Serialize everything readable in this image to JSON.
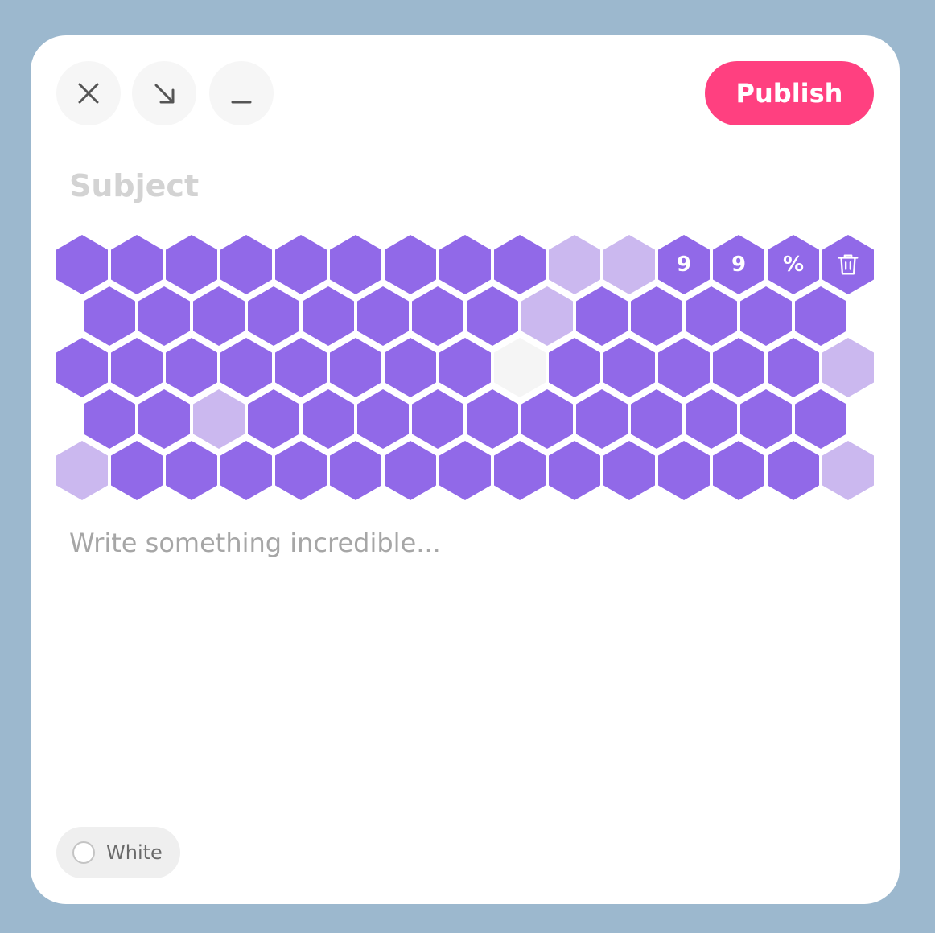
{
  "window_controls": {
    "close_icon": "close-icon",
    "resize_icon": "arrow-down-right-icon",
    "minimize_icon": "minimize-icon"
  },
  "publish_label": "Publish",
  "subject": {
    "value": "",
    "placeholder": "Subject"
  },
  "body": {
    "value": "",
    "placeholder": "Write something incredible..."
  },
  "theme_toggle": {
    "label": "White",
    "selected": false
  },
  "colors": {
    "background": "#9cb8ce",
    "card": "#ffffff",
    "publish": "#ff4080",
    "hex_filled": "#9169e8",
    "hex_light": "#cbb8ef",
    "hex_empty": "#f5f5f5"
  },
  "honeycomb": {
    "legend": "f = filled purple, l = light lavender, e = empty gray",
    "rows": [
      "fffffffffllfffff",
      "fffffffflfffff",
      "ffffffffefffffl",
      "fflfffffffffff",
      "lffffffffffffflf"
    ],
    "overlay": [
      {
        "row": 0,
        "col": 11,
        "text": "9"
      },
      {
        "row": 0,
        "col": 12,
        "text": "9"
      },
      {
        "row": 0,
        "col": 13,
        "text": "%"
      },
      {
        "row": 0,
        "col": 14,
        "icon": "trash-icon"
      }
    ]
  }
}
